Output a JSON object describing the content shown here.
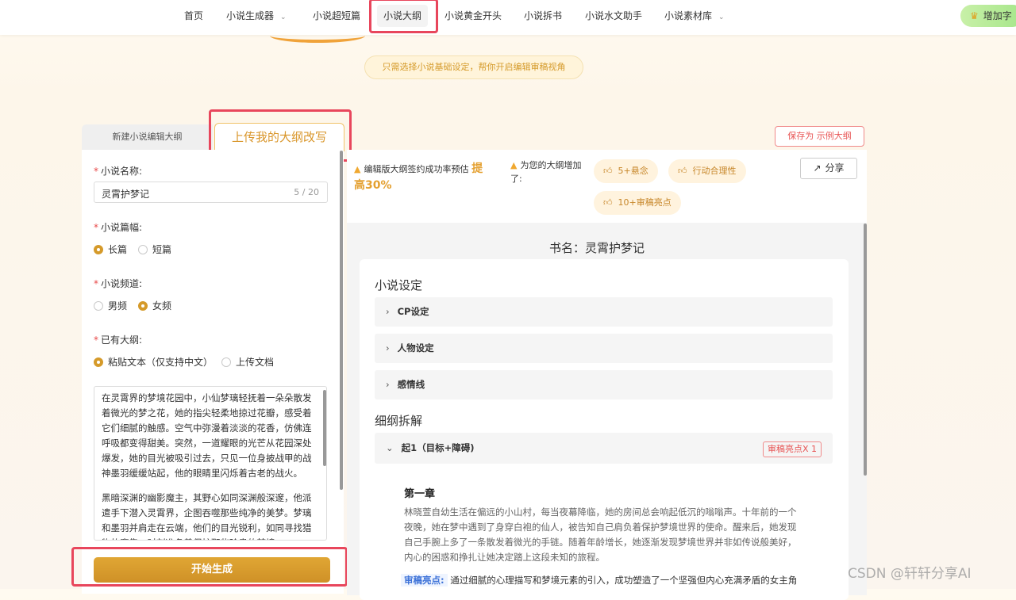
{
  "nav": {
    "items": [
      {
        "label": "首页",
        "has_dropdown": false
      },
      {
        "label": "小说生成器",
        "has_dropdown": true
      },
      {
        "label": "小说超短篇",
        "has_dropdown": false
      },
      {
        "label": "小说大纲",
        "has_dropdown": false,
        "active": true
      },
      {
        "label": "小说黄金开头",
        "has_dropdown": false
      },
      {
        "label": "小说拆书",
        "has_dropdown": false
      },
      {
        "label": "小说水文助手",
        "has_dropdown": false
      },
      {
        "label": "小说素材库",
        "has_dropdown": true
      }
    ],
    "upgrade_label": "增加字"
  },
  "hero": {
    "pill_text": "只需选择小说基础设定，帮你开启编辑审稿视角"
  },
  "left": {
    "tab_new": "新建小说编辑大纲",
    "tab_upload": "上传我的大纲改写",
    "name_label": "小说名称:",
    "name_value": "灵霄护梦记",
    "name_count": "5 / 20",
    "length_label": "小说篇幅:",
    "length_opt1": "长篇",
    "length_opt2": "短篇",
    "channel_label": "小说频道:",
    "channel_opt1": "男频",
    "channel_opt2": "女频",
    "outline_label": "已有大纲:",
    "outline_opt1": "粘贴文本（仅支持中文）",
    "outline_opt2": "上传文档",
    "outline_p1": "在灵霄界的梦境花园中，小仙梦璃轻抚着一朵朵散发着微光的梦之花，她的指尖轻柔地掠过花瓣，感受着它们细腻的触感。空气中弥漫着淡淡的花香，仿佛连呼吸都变得甜美。突然，一道耀眼的光芒从花园深处爆发，她的目光被吸引过去，只见一位身披战甲的战神墨羽缓缓站起，他的眼睛里闪烁着古老的战火。",
    "outline_p2": "黑暗深渊的幽影魔主，其野心如同深渊般深邃，他派遣手下潜入灵霄界，企图吞噬那些纯净的美梦。梦璃和墨羽并肩走在云端，他们的目光锐利，如同寻找猎物的鹰隼，时刻准备着保护那些珍贵的梦境。",
    "generate_label": "开始生成"
  },
  "right": {
    "save_label": "保存为  示例大纲",
    "hint1": "编辑版大纲签约成功率预估",
    "hint1_em1": "提",
    "hint1_em2": "高30%",
    "hint2": "为您的大纲增加了:",
    "tag1": "5+悬念",
    "tag2": "行动合理性",
    "tag3": "10+审稿亮点",
    "share_label": "分享",
    "book_title": "书名：灵霄护梦记",
    "section_setting": "小说设定",
    "acc1": "CP设定",
    "acc2": "人物设定",
    "acc3": "感情线",
    "section_detail": "细纲拆解",
    "acc4": "起1（目标+障碍)",
    "highlight_tag": "审稿亮点X 1",
    "chapter_title": "第一章",
    "chapter_text": "林晓萱自幼生活在偏远的小山村，每当夜幕降临，她的房间总会响起低沉的嗡嗡声。十年前的一个夜晚，她在梦中遇到了身穿白袍的仙人，被告知自己肩负着保护梦境世界的使命。醒来后，她发现自己手腕上多了一条散发着微光的手链。随着年龄增长，她逐渐发现梦境世界并非如传说般美好，内心的困惑和挣扎让她决定踏上这段未知的旅程。",
    "review_key": "审稿亮点:",
    "review_text": "通过细腻的心理描写和梦境元素的引入，成功塑造了一个坚强但内心充满矛盾的女主角"
  },
  "watermark": "CSDN @轩轩分享AI",
  "colors": {
    "accent": "#d59a2a",
    "highlight_box": "#e8465c"
  }
}
